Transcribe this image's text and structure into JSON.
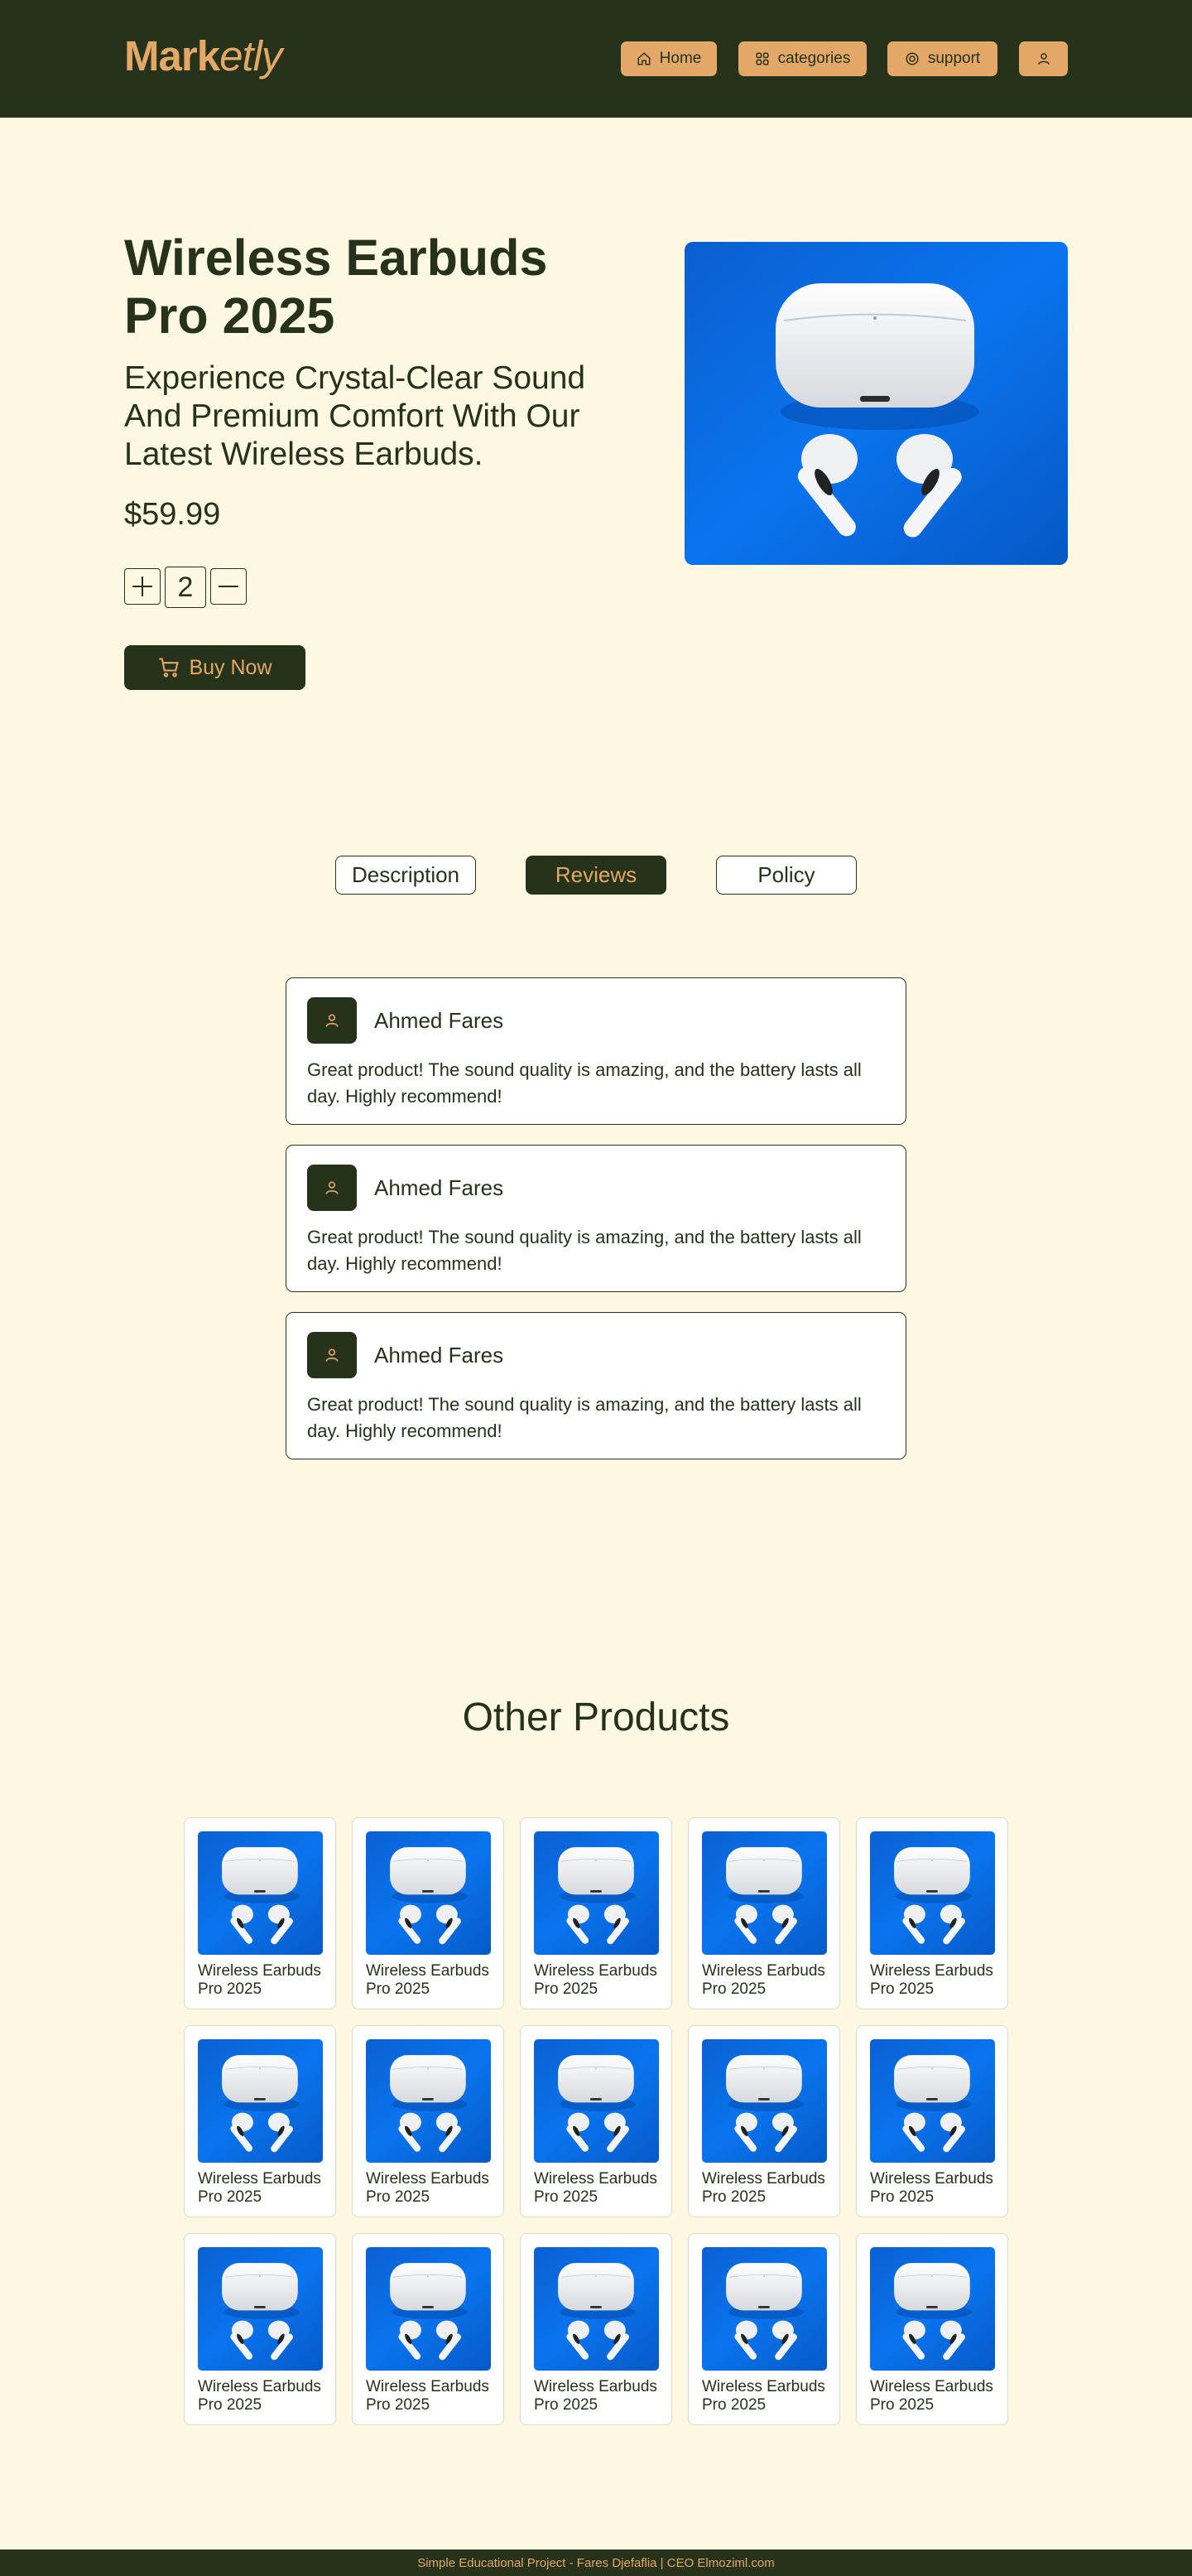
{
  "header": {
    "logo_bold": "Mark",
    "logo_italic": "etly",
    "nav": [
      {
        "label": "Home",
        "icon": "home-icon"
      },
      {
        "label": "categories",
        "icon": "categories-icon"
      },
      {
        "label": "support",
        "icon": "support-icon"
      },
      {
        "label": "",
        "icon": "user-icon"
      }
    ]
  },
  "colors": {
    "background": "#fdf8e1",
    "dark_green": "#27321a",
    "accent": "#e3a868",
    "product_blue": "#0a6fe0"
  },
  "product": {
    "title": "Wireless Earbuds Pro 2025",
    "subtitle": "Experience Crystal-Clear Sound And Premium Comfort With Our Latest Wireless Earbuds.",
    "price": "$59.99",
    "quantity": "2",
    "buy_label": "Buy Now"
  },
  "tabs": [
    {
      "label": "Description",
      "active": false
    },
    {
      "label": "Reviews",
      "active": true
    },
    {
      "label": "Policy",
      "active": false
    }
  ],
  "reviews": [
    {
      "name": "Ahmed Fares",
      "text": "Great product! The sound quality is amazing, and the battery lasts all day. Highly recommend!"
    },
    {
      "name": "Ahmed Fares",
      "text": "Great product! The sound quality is amazing, and the battery lasts all day. Highly recommend!"
    },
    {
      "name": "Ahmed Fares",
      "text": "Great product! The sound quality is amazing, and the battery lasts all day. Highly recommend!"
    }
  ],
  "other_products": {
    "title": "Other Products",
    "items": [
      {
        "name": "Wireless Earbuds Pro 2025"
      },
      {
        "name": "Wireless Earbuds Pro 2025"
      },
      {
        "name": "Wireless Earbuds Pro 2025"
      },
      {
        "name": "Wireless Earbuds Pro 2025"
      },
      {
        "name": "Wireless Earbuds Pro 2025"
      },
      {
        "name": "Wireless Earbuds Pro 2025"
      },
      {
        "name": "Wireless Earbuds Pro 2025"
      },
      {
        "name": "Wireless Earbuds Pro 2025"
      },
      {
        "name": "Wireless Earbuds Pro 2025"
      },
      {
        "name": "Wireless Earbuds Pro 2025"
      },
      {
        "name": "Wireless Earbuds Pro 2025"
      },
      {
        "name": "Wireless Earbuds Pro 2025"
      },
      {
        "name": "Wireless Earbuds Pro 2025"
      },
      {
        "name": "Wireless Earbuds Pro 2025"
      },
      {
        "name": "Wireless Earbuds Pro 2025"
      }
    ]
  },
  "footer": {
    "text": "Simple Educational Project - Fares Djefaflia | CEO Elmoziml.com"
  }
}
